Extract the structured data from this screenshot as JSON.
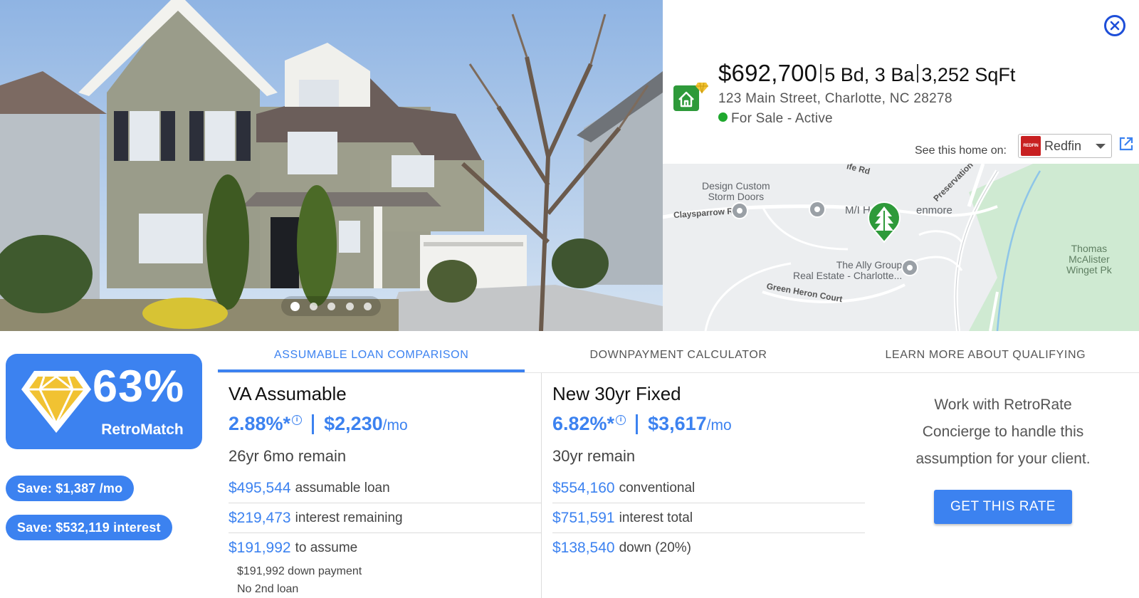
{
  "listing": {
    "price": "$692,700",
    "beds_baths": "5 Bd, 3 Ba",
    "sqft": "3,252 SqFt",
    "address": "123 Main Street, Charlotte, NC 28278",
    "status": "For Sale - Active",
    "status_color": "#1fa82e"
  },
  "source": {
    "label": "See this home on:",
    "selected": "Redfin",
    "logo_text": "REDFIN",
    "logo_color": "#c82021"
  },
  "photo_carousel": {
    "total": 5,
    "active_index": 0
  },
  "map": {
    "labels": {
      "design_custom": "Design Custom",
      "storm_doors": "Storm Doors",
      "claysparrow": "Claysparrow Rd",
      "mi_homes": "M/I Hom",
      "glenmore": "enmore",
      "preservation": "Preservation",
      "rd_fragment": "ife Rd",
      "ally_group_1": "The Ally Group",
      "ally_group_2": "Real Estate - Charlotte...",
      "green_heron": "Green Heron Court",
      "thomas_1": "Thomas",
      "thomas_2": "McAlister",
      "thomas_3": "Winget Pk"
    }
  },
  "match": {
    "percent": "63%",
    "label": "RetroMatch"
  },
  "savings": {
    "monthly": "Save: $1,387 /mo",
    "interest": "Save: $532,119 interest"
  },
  "tabs": [
    {
      "label": "ASSUMABLE LOAN COMPARISON",
      "active": true
    },
    {
      "label": "DOWNPAYMENT CALCULATOR",
      "active": false
    },
    {
      "label": "LEARN MORE ABOUT QUALIFYING",
      "active": false
    }
  ],
  "va_loan": {
    "title": "VA Assumable",
    "rate": "2.88%*",
    "payment": "$2,230",
    "per": "/mo",
    "remain": "26yr 6mo remain",
    "stats": [
      {
        "amount": "$495,544",
        "label": "assumable loan"
      },
      {
        "amount": "$219,473",
        "label": "interest remaining"
      },
      {
        "amount": "$191,992",
        "label": "to assume"
      }
    ],
    "details": [
      "$191,992 down payment",
      "No 2nd loan"
    ]
  },
  "new_loan": {
    "title": "New 30yr Fixed",
    "rate": "6.82%*",
    "payment": "$3,617",
    "per": "/mo",
    "remain": "30yr remain",
    "stats": [
      {
        "amount": "$554,160",
        "label": "conventional"
      },
      {
        "amount": "$751,591",
        "label": "interest total"
      },
      {
        "amount": "$138,540",
        "label": "down (20%)"
      }
    ]
  },
  "concierge": {
    "text": "Work with RetroRate Concierge to handle this assumption for your client.",
    "button": "GET THIS RATE"
  },
  "colors": {
    "accent": "#3c82f0",
    "gem": "#f1c232",
    "close": "#1d4ed8"
  },
  "icons": [
    "close-icon",
    "home-logo-icon",
    "external-link-icon",
    "diamond-icon",
    "info-icon",
    "map-pin-icon",
    "tree-marker-icon",
    "caret-down-icon"
  ]
}
